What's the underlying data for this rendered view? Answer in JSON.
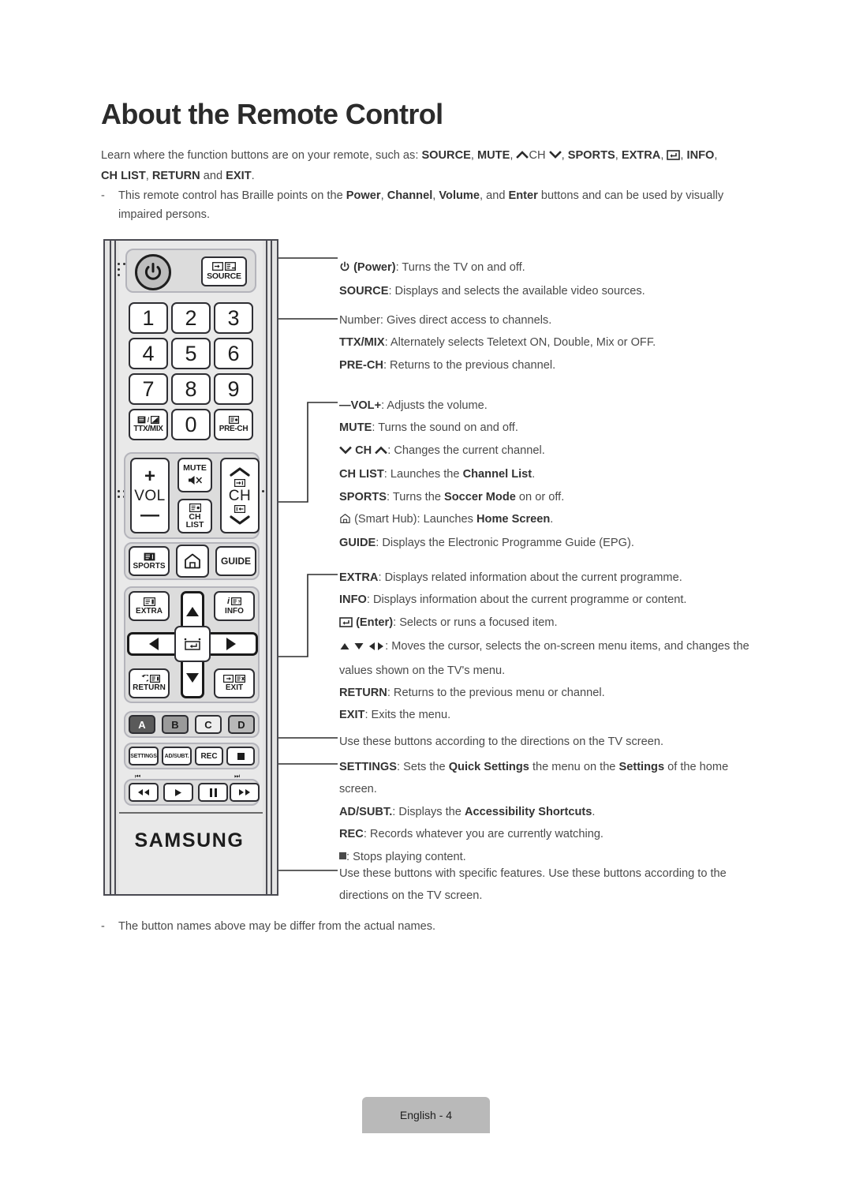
{
  "page": {
    "title": "About the Remote Control",
    "footer_label": "English - 4"
  },
  "intro": {
    "line1_pre": "Learn where the function buttons are on your remote, such as: ",
    "b_source": "SOURCE",
    "b_mute": "MUTE",
    "t_ch": "CH",
    "b_sports": "SPORTS",
    "b_extra": "EXTRA",
    "b_info": "INFO",
    "b_chlist": "CH LIST",
    "b_return": "RETURN",
    "b_exit": "EXIT",
    "and_word": "and",
    "bullet_dash": "-",
    "bullet_pre": "This remote control has Braille points on the ",
    "bullet_power": "Power",
    "bullet_channel": "Channel",
    "bullet_volume": "Volume",
    "bullet_enter": "Enter",
    "bullet_post": " buttons and can be used by visually impaired persons."
  },
  "footnote": {
    "dash": "-",
    "text": "The button names above may be differ from the actual names."
  },
  "remote": {
    "brand": "SAMSUNG",
    "keys": {
      "source": "SOURCE",
      "n1": "1",
      "n2": "2",
      "n3": "3",
      "n4": "4",
      "n5": "5",
      "n6": "6",
      "n7": "7",
      "n8": "8",
      "n9": "9",
      "n0": "0",
      "ttxmix": "TTX/MIX",
      "prech": "PRE-CH",
      "vol_plus": "+",
      "vol": "VOL",
      "vol_minus": "—",
      "mute": "MUTE",
      "ch_list_1": "CH",
      "ch_list_2": "LIST",
      "ch": "CH",
      "sports": "SPORTS",
      "guide": "GUIDE",
      "extra": "EXTRA",
      "info": "INFO",
      "return": "RETURN",
      "exit": "EXIT",
      "color_a": "A",
      "color_b": "B",
      "color_c": "C",
      "color_d": "D",
      "settings": "SETTINGS",
      "adsubt": "AD/SUBT.",
      "rec": "REC"
    }
  },
  "descriptions": {
    "group1": {
      "power_label": "(Power)",
      "power_text": ": Turns the TV on and off.",
      "source_label": "SOURCE",
      "source_text": ": Displays and selects the available video sources."
    },
    "group2": {
      "number_label": "Number",
      "number_text": ": Gives direct access to channels.",
      "ttx_label": "TTX/MIX",
      "ttx_text": ": Alternately selects Teletext ON, Double, Mix or OFF.",
      "prech_label": "PRE-CH",
      "prech_text": ": Returns to the previous channel."
    },
    "group3": {
      "vol_label": "VOL",
      "vol_text": ": Adjusts the volume.",
      "mute_label": "MUTE",
      "mute_text": ": Turns the sound on and off.",
      "ch_label": "CH",
      "ch_text": ": Changes the current channel.",
      "chlist_label": "CH LIST",
      "chlist_text_pre": ": Launches the ",
      "chlist_bold": "Channel List",
      "chlist_text_post": ".",
      "sports_label": "SPORTS",
      "sports_text_pre": ": Turns the ",
      "sports_bold": "Soccer Mode",
      "sports_text_post": " on or off.",
      "smarthub_label": "(Smart Hub)",
      "smarthub_text_pre": ": Launches ",
      "smarthub_bold": "Home Screen",
      "smarthub_text_post": ".",
      "guide_label": "GUIDE",
      "guide_text": ": Displays the Electronic Programme Guide (EPG)."
    },
    "group4": {
      "extra_label": "EXTRA",
      "extra_text": ": Displays related information about the current programme.",
      "info_label": "INFO",
      "info_text": ": Displays information about the current programme or content.",
      "enter_label": "(Enter)",
      "enter_text": ": Selects or runs a focused item.",
      "arrows_text": ": Moves the cursor, selects the on-screen menu items, and changes the values shown on the TV's menu.",
      "return_label": "RETURN",
      "return_text": ": Returns to the previous menu or channel.",
      "exit_label": "EXIT",
      "exit_text": ": Exits the menu."
    },
    "group5": {
      "colour_text": "Use these buttons according to the directions on the TV screen."
    },
    "group6": {
      "settings_label": "SETTINGS",
      "settings_pre": ": Sets the ",
      "settings_bold1": "Quick Settings",
      "settings_mid": " the menu on the ",
      "settings_bold2": "Settings",
      "settings_post": " of the home screen.",
      "adsubt_label": "AD/SUBT.",
      "adsubt_pre": ": Displays the ",
      "adsubt_bold": "Accessibility Shortcuts",
      "adsubt_post": ".",
      "rec_label": "REC",
      "rec_text": ": Records whatever you are currently watching.",
      "stop_text": ": Stops playing content."
    },
    "group7": {
      "playback_text": "Use these buttons with specific features. Use these buttons according to the directions on the TV screen."
    }
  }
}
